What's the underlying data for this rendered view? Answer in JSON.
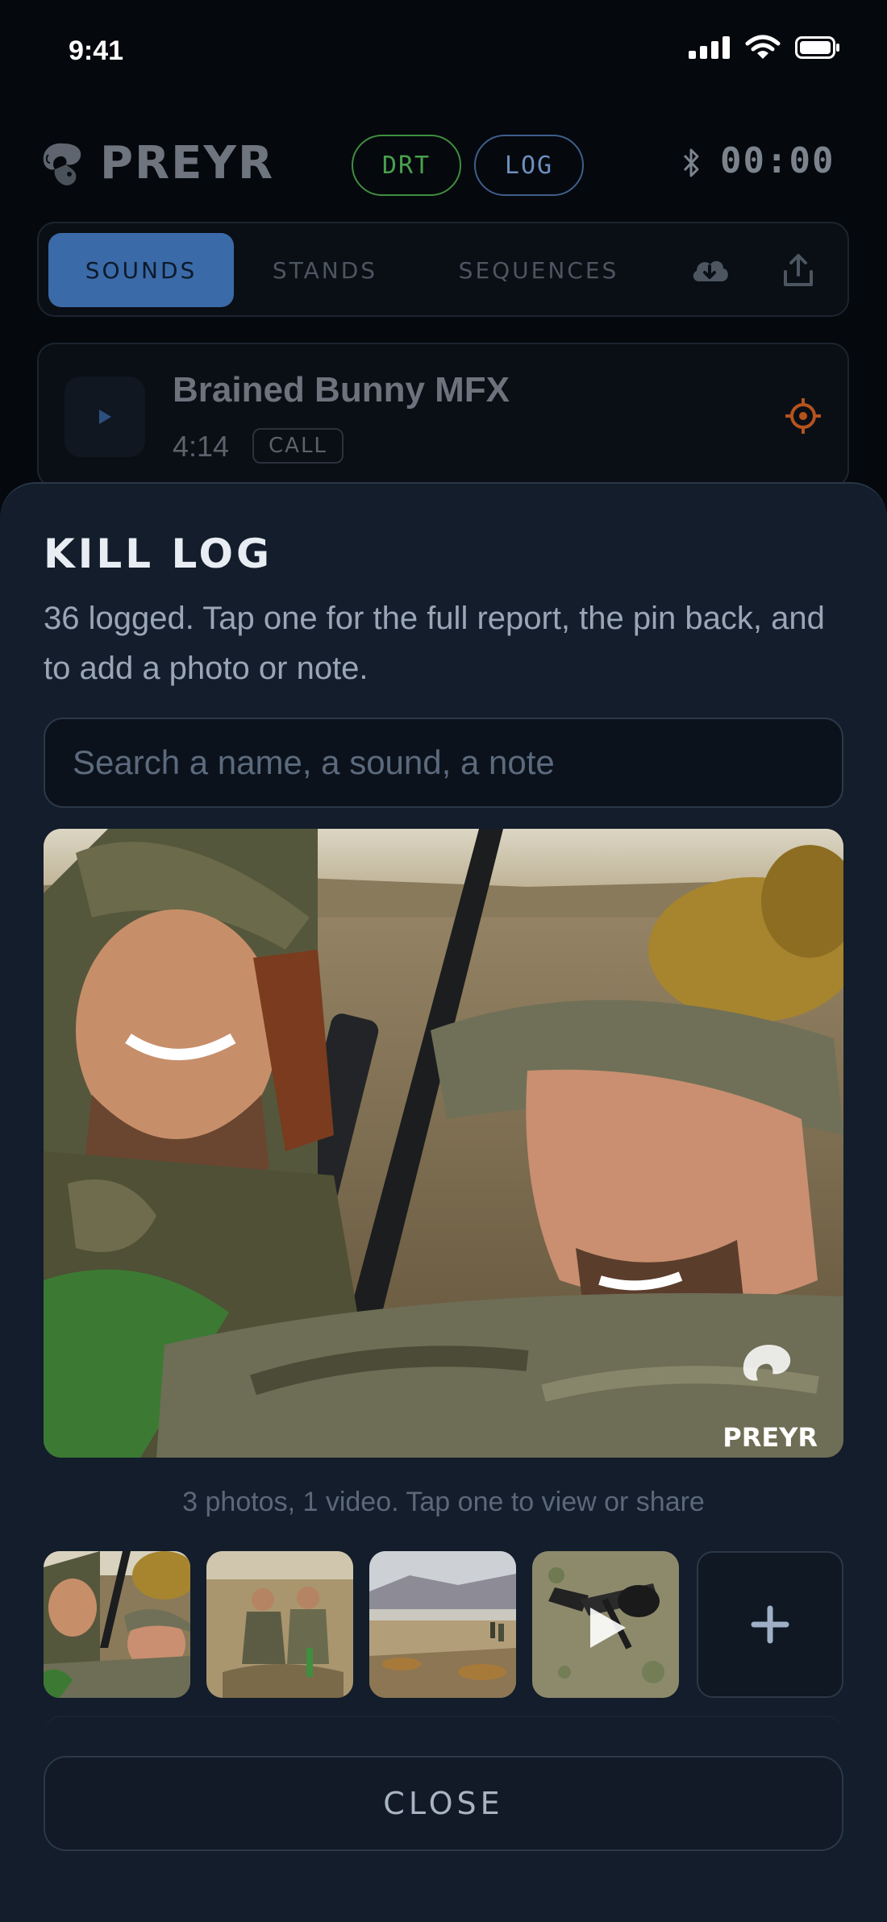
{
  "status_bar": {
    "time": "9:41"
  },
  "header": {
    "logo_text": "PREYR",
    "mode_pills": [
      "DRT",
      "LOG"
    ],
    "timer": "00:00"
  },
  "tabs": {
    "items": [
      "SOUNDS",
      "STANDS",
      "SEQUENCES"
    ],
    "active": "SOUNDS",
    "icons": [
      "cloud-download-icon",
      "share-upload-icon"
    ]
  },
  "sound_row": {
    "title": "Brained Bunny MFX",
    "duration": "4:14",
    "badge": "CALL"
  },
  "kill_log": {
    "title": "KILL LOG",
    "subtitle": "36 logged. Tap one for the full report, the pin back, and to add a photo or note.",
    "search_placeholder": "Search a name, a sound, a note",
    "watermark": "PREYR",
    "media_caption": "3 photos, 1 video. Tap one to view or share",
    "close_label": "CLOSE"
  },
  "colors": {
    "accent_blue": "#3b6aa8",
    "drt_green": "#49a04d",
    "target_orange": "#c8581a",
    "sheet_bg": "#131d2b"
  }
}
